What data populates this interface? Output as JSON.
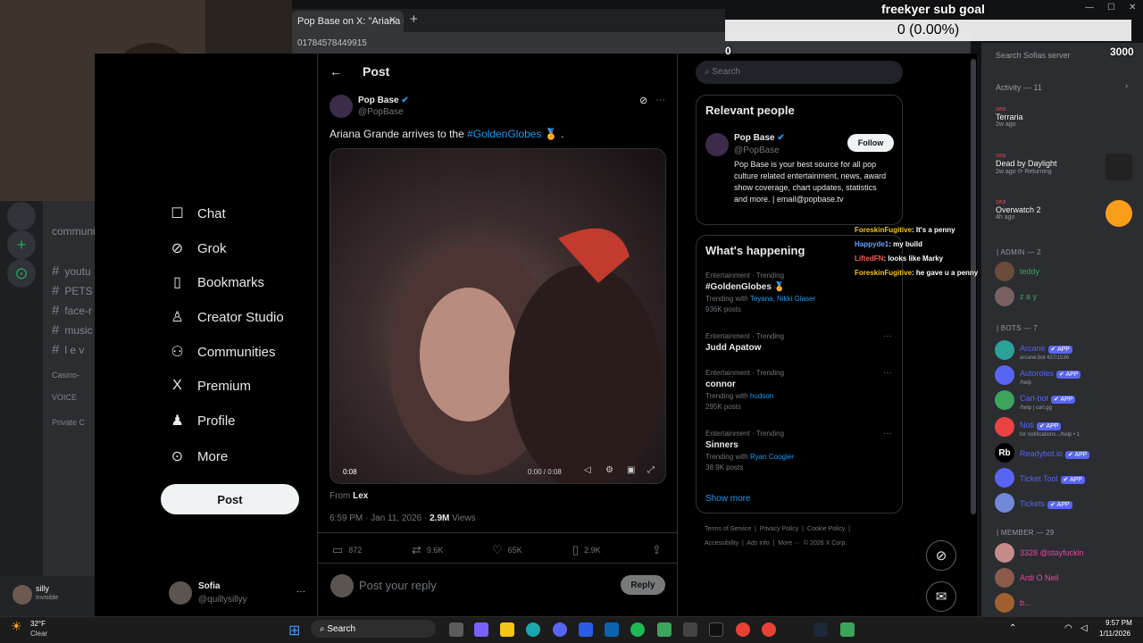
{
  "overlay": {
    "sub_goal_title": "freekyer sub goal",
    "sub_goal_value": "0 (0.00%)",
    "sub_goal_count_left": "0",
    "sub_goal_count_right": "3000",
    "chat": [
      {
        "user": "ForeskinFugitive",
        "msg": ": It's a penny",
        "color": "#f5c518"
      },
      {
        "user": "Happyde1",
        "msg": ": my build",
        "color": "#6aa0ff"
      },
      {
        "user": "LiftedFN",
        "msg": ": looks like Marky",
        "color": "#ff5a5a"
      },
      {
        "user": "ForeskinFugitive",
        "msg": ": he gave u a penny",
        "color": "#f5c518"
      }
    ]
  },
  "browser": {
    "tab_title": "Pop Base on X: \"Ariana Grande",
    "url": "2017845784499 15",
    "url_display": "01784578449915"
  },
  "x_nav": {
    "items": [
      {
        "label": "Chat",
        "icon": "chat-icon",
        "glyph": "☐"
      },
      {
        "label": "Grok",
        "icon": "grok-icon",
        "glyph": "⊘"
      },
      {
        "label": "Bookmarks",
        "icon": "bookmark-icon",
        "glyph": "▯"
      },
      {
        "label": "Creator Studio",
        "icon": "creator-studio-icon",
        "glyph": "♙"
      },
      {
        "label": "Communities",
        "icon": "communities-icon",
        "glyph": "⚇"
      },
      {
        "label": "Premium",
        "icon": "x-premium-icon",
        "glyph": "X"
      },
      {
        "label": "Profile",
        "icon": "profile-icon",
        "glyph": "♟"
      },
      {
        "label": "More",
        "icon": "more-icon",
        "glyph": "⊙"
      }
    ],
    "post_button": "Post",
    "account_name": "Sofia",
    "account_handle": "@quillysillyy"
  },
  "post": {
    "header": "Post",
    "author_name": "Pop Base",
    "author_handle": "@PopBase",
    "text_prefix": "Ariana Grande arrives to the ",
    "hashtag": "#GoldenGlobes",
    "text_suffix": " 🏅 .",
    "video_time": "0:08",
    "video_progress": "0:00 / 0:08",
    "from_label": "From ",
    "from_name": "Lex",
    "timestamp": "6:59 PM · Jan 11, 2026 · ",
    "views_count": "2.9M",
    "views_label": " Views",
    "replies": "872",
    "reposts": "9.6K",
    "likes": "65K",
    "bookmarks": "2.9K",
    "reply_placeholder": "Post your reply",
    "reply_button": "Reply"
  },
  "sidebar": {
    "search_placeholder": "Search",
    "relevant_title": "Relevant people",
    "relevant_name": "Pop Base",
    "relevant_handle": "@PopBase",
    "follow_button": "Follow",
    "relevant_bio": "Pop Base is your best source for all pop culture related entertainment, news, award show coverage, chart updates, statistics and more. | email@popbase.tv",
    "happening_title": "What's happening",
    "trends": [
      {
        "category": "Entertainment · Trending",
        "name": "#GoldenGlobes 🏅",
        "with_label": "Trending with ",
        "with": "Teyana, Nikki Glaser",
        "posts": "936K posts"
      },
      {
        "category": "Entertainment · Trending",
        "name": "Judd Apatow",
        "with_label": "",
        "with": "",
        "posts": ""
      },
      {
        "category": "Entertainment · Trending",
        "name": "connor",
        "with_label": "Trending with ",
        "with": "hudson",
        "posts": "295K posts"
      },
      {
        "category": "Entertainment · Trending",
        "name": "Sinners",
        "with_label": "Trending with ",
        "with": "Ryan Coogler",
        "posts": "38.9K posts"
      }
    ],
    "show_more": "Show more",
    "footer_line1": "Terms of Service  |  Privacy Policy  |  Cookie Policy  |",
    "footer_line2": "Accessibility  |  Ads info  |  More ···  © 2026 X Corp."
  },
  "discord": {
    "channels": [
      {
        "label": "community"
      },
      {
        "label": "youtu"
      },
      {
        "label": "PETS"
      },
      {
        "label": "face-r"
      },
      {
        "label": "music"
      },
      {
        "label": "l e v"
      }
    ],
    "casino": "Casino-",
    "voice": "VOICE",
    "private": "Private C",
    "user_name": "silly",
    "user_status": "Invisible",
    "server_search": "Search Sofias server",
    "activity_label": "Activity — 11",
    "activities": [
      {
        "user": "sea",
        "game": "Terraria",
        "time": "2w ago"
      },
      {
        "user": "sea",
        "game": "Dead by Daylight",
        "time": "2w ago  ⟳ Returning"
      },
      {
        "user": "sea",
        "game": "Overwatch 2",
        "time": "4h ago"
      }
    ],
    "admin_section": "| ADMIN — 2",
    "admins": [
      {
        "name": "teddy",
        "tag": "BAU"
      },
      {
        "name": "z a y",
        "sub": "Roblox"
      }
    ],
    "bots_section": "| BOTS — 7",
    "bots": [
      {
        "name": "Arcane",
        "sub": "arcane.bot 437/1536",
        "color": "#2aa198"
      },
      {
        "name": "Autoroles",
        "sub": "/help",
        "color": "#5865f2"
      },
      {
        "name": "Carl-bot",
        "sub": "/help | carl.gg",
        "color": "#3ba55c"
      },
      {
        "name": "Noti",
        "sub": "for notifications.../help • 1",
        "color": "#ed4245"
      },
      {
        "name": "Readybot.io",
        "sub": "",
        "color": "#ffffff"
      },
      {
        "name": "Ticket Tool",
        "sub": "",
        "color": "#5865f2"
      },
      {
        "name": "Tickets",
        "sub": "",
        "color": "#5865f2"
      }
    ],
    "app_badge": "✔ APP",
    "member_section": "| MEMBER — 29",
    "members": [
      {
        "name": "3328 @stayfuckin"
      },
      {
        "name": "Ardi O Neil"
      },
      {
        "name": "b..."
      }
    ]
  },
  "taskbar": {
    "weather_temp": "32°F",
    "weather_desc": "Clear",
    "search": "Search",
    "time": "9:57 PM",
    "date": "1/11/2026"
  }
}
